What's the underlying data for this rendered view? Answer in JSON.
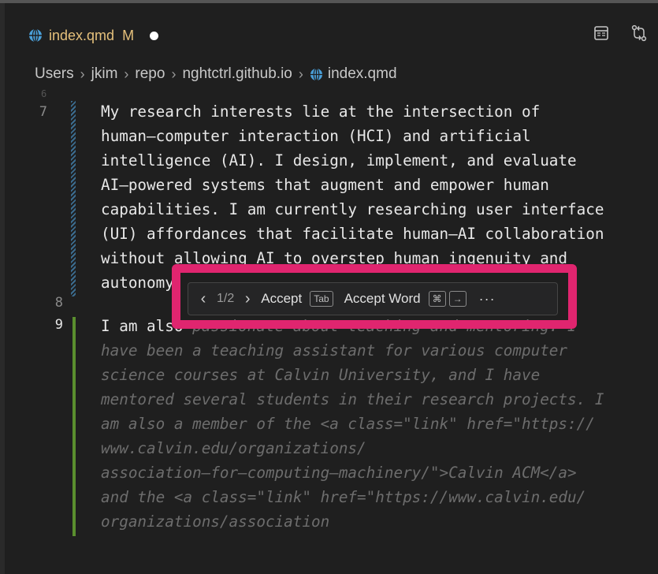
{
  "tab": {
    "filename": "index.qmd",
    "modified_flag": "M",
    "unsaved_indicator": "●",
    "file_icon": "globe-icon",
    "actions": [
      "preview-icon",
      "source-control-compare-icon"
    ]
  },
  "breadcrumb": [
    "Users",
    "jkim",
    "repo",
    "nghtctrl.github.io",
    "index.qmd"
  ],
  "editor": {
    "faded_top_number": "6",
    "line_numbers": [
      "7",
      "8",
      "9"
    ],
    "para1": [
      "My research interests lie at the intersection of",
      "human–computer interaction (HCI) and artificial",
      "intelligence (AI). I design, implement, and evaluate",
      "AI–powered systems that augment and empower human",
      "capabilities. I am currently researching user interface",
      "(UI) affordances that facilitate human–AI collaboration",
      "without allowing AI to overstep human ingenuity and",
      "autonomy."
    ],
    "para2_typed": "I am also ",
    "para2_ghost_first": "passionate about teaching and mentoring. I",
    "para2_ghost": [
      "have been a teaching assistant for various computer",
      "science courses at Calvin University, and I have",
      "mentored several students in their research projects. I",
      "am also a member of the <a class=\"link\" href=\"https://",
      "www.calvin.edu/organizations/",
      "association–for–computing–machinery/\">Calvin ACM</a>",
      "and the <a class=\"link\" href=\"https://www.calvin.edu/",
      "organizations/association"
    ]
  },
  "suggestion": {
    "prev": "‹",
    "counter": "1/2",
    "next": "›",
    "accept": "Accept",
    "accept_key": "Tab",
    "accept_word": "Accept Word",
    "accept_word_key1": "⌘",
    "accept_word_key2": "→",
    "more": "···"
  },
  "colors": {
    "highlight": "#e0256f",
    "modified": "#e5c07b",
    "change_bar": "#5a8f2e",
    "ghost_text": "#6d6d6d"
  }
}
